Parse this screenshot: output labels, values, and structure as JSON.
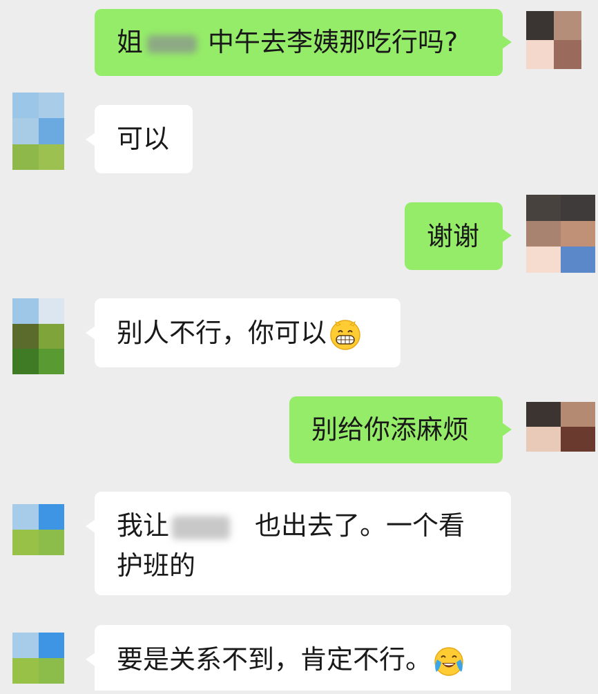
{
  "messages": [
    {
      "sender": "me",
      "parts": [
        "姐",
        "中午去李姨那吃行吗?"
      ],
      "redacted": true
    },
    {
      "sender": "them",
      "text": "可以"
    },
    {
      "sender": "me",
      "text": "谢谢"
    },
    {
      "sender": "them",
      "text": "别人不行，你可以",
      "emoji": "grinning-face-icon"
    },
    {
      "sender": "me",
      "text": "别给你添麻烦"
    },
    {
      "sender": "them",
      "parts": [
        "我让",
        "也出去了。一个看",
        "护班的"
      ],
      "redacted": true
    },
    {
      "sender": "them",
      "text": "要是关系不到，肯定不行。",
      "emoji": "tears-of-joy-face-icon"
    }
  ],
  "colors": {
    "background": "#ededed",
    "my_bubble": "#95ec69",
    "their_bubble": "#ffffff"
  }
}
